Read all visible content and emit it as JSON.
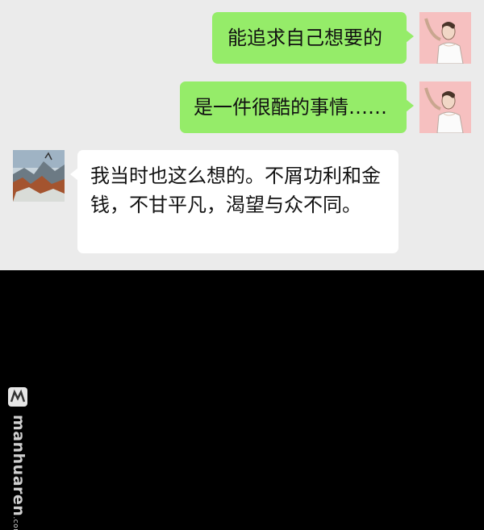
{
  "messages": [
    {
      "sender": "self",
      "text": "能追求自己想要的"
    },
    {
      "sender": "self",
      "text": "是一件很酷的事情……"
    },
    {
      "sender": "other",
      "text": "我当时也这么想的。不屑功利和金钱，不甘平凡，渴望与众不同。"
    }
  ],
  "watermark": {
    "brand": "manhuaren",
    "suffix": ".com"
  },
  "colors": {
    "chat_background": "#ebebeb",
    "self_bubble": "#95ec69",
    "other_bubble": "#ffffff",
    "lower_area": "#000000"
  }
}
